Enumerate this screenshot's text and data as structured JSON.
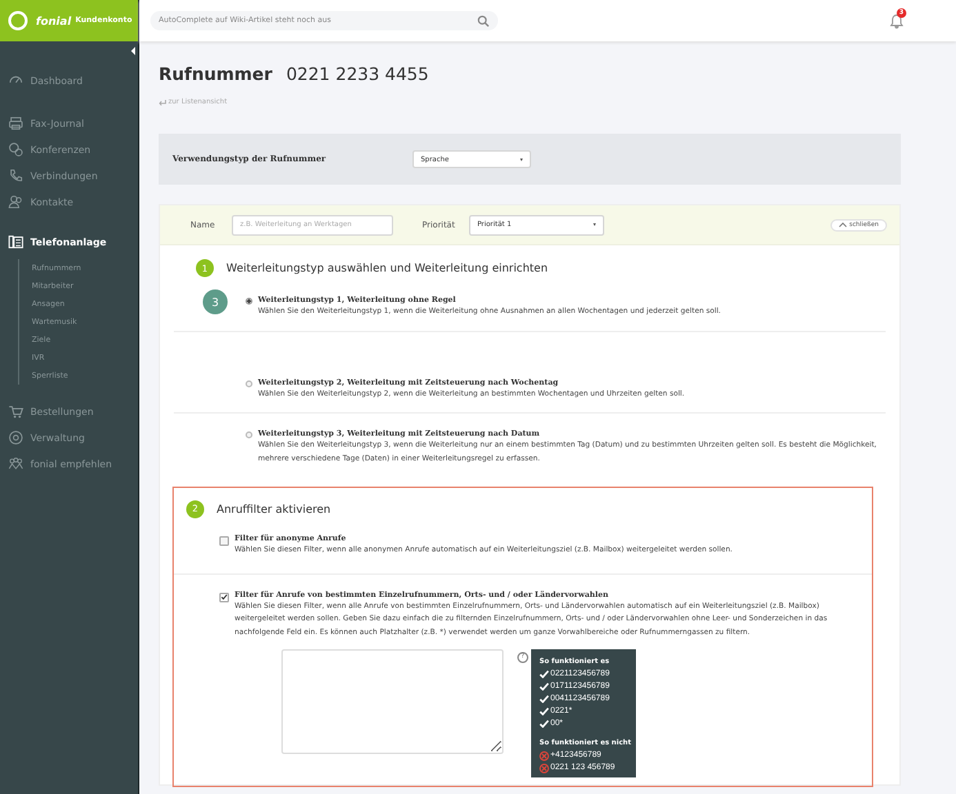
{
  "app": {
    "brand": "fonial",
    "brand_suffix": "Kundenkonto",
    "search": {
      "placeholder": "AutoComplete auf Wiki-Artikel steht noch aus"
    },
    "notifications": {
      "count": "3"
    }
  },
  "sidebar": {
    "items": [
      {
        "label": "Dashboard",
        "selected": false
      },
      {
        "label": "Fax-Journal",
        "selected": false
      },
      {
        "label": "Konferenzen",
        "selected": false
      },
      {
        "label": "Verbindungen",
        "selected": false
      },
      {
        "label": "Kontakte",
        "selected": false
      },
      {
        "label": "Telefonanlage",
        "selected": true,
        "children": [
          {
            "label": "Rufnummern",
            "selected": false
          },
          {
            "label": "Mitarbeiter",
            "selected": false
          },
          {
            "label": "Ansagen",
            "selected": false
          },
          {
            "label": "Wartemusik",
            "selected": false
          },
          {
            "label": "Ziele",
            "selected": false
          },
          {
            "label": "IVR",
            "selected": false
          },
          {
            "label": "Sperrliste",
            "selected": false
          }
        ]
      },
      {
        "label": "Bestellungen",
        "selected": false
      },
      {
        "label": "Verwaltung",
        "selected": false
      },
      {
        "label": "fonial empfehlen",
        "selected": false
      }
    ]
  },
  "page": {
    "title": "Rufnummer",
    "number": "0221 2233 4455",
    "back_link": "zur Listenansicht"
  },
  "usage": {
    "label": "Verwendungstyp der Rufnummer",
    "value": "Sprache"
  },
  "rule": {
    "name_label": "Name",
    "name_placeholder": "z.B. Weiterleitung an Werktagen",
    "priority_label": "Priorität",
    "priority_value": "Priorität 1",
    "close_button": "schließen"
  },
  "step1": {
    "number": "1",
    "title": "Weiterleitungstyp auswählen und Weiterleitung einrichten",
    "marker": "3",
    "options": [
      {
        "title": "Weiterleitungstyp 1, Weiterleitung ohne Regel",
        "description": "Wählen Sie den Weiterleitungstyp 1, wenn die Weiterleitung ohne Ausnahmen an allen Wochentagen und jederzeit gelten soll.",
        "selected": true
      },
      {
        "title": "Weiterleitungstyp 2, Weiterleitung mit Zeitsteuerung nach Wochentag",
        "description": "Wählen Sie den Weiterleitungstyp 2, wenn die Weiterleitung an bestimmten Wochentagen und Uhrzeiten gelten soll.",
        "selected": false
      },
      {
        "title": "Weiterleitungstyp 3, Weiterleitung mit Zeitsteuerung nach Datum",
        "description": "Wählen Sie den Weiterleitungstyp 3, wenn die Weiterleitung nur an einem bestimmten Tag (Datum) und zu bestimmten Uhrzeiten gelten soll. Es besteht die Möglichkeit, mehrere verschiedene Tage (Daten) in einer Weiterleitungsregel zu erfassen.",
        "selected": false
      }
    ]
  },
  "step2": {
    "number": "2",
    "title": "Anruffilter aktivieren",
    "filters": [
      {
        "title": "Filter für anonyme Anrufe",
        "description": "Wählen Sie diesen Filter, wenn alle anonymen Anrufe automatisch auf ein Weiterleitungsziel (z.B. Mailbox) weitergeleitet werden sollen.",
        "checked": false,
        "kind": "plain"
      },
      {
        "title": "Filter für Anrufe von bestimmten Einzelrufnummern, Orts- und / oder Ländervorwahlen",
        "description": "Wählen Sie diesen Filter, wenn alle Anrufe von bestimmten Einzelrufnummern, Orts- und Ländervorwahlen automatisch auf ein Weiterleitungsziel (z.B. Mailbox) weitergeleitet werden sollen. Geben Sie dazu einfach die zu filternden Einzelrufnummern, Orts- und / oder Ländervorwahlen ohne Leer- und Sonderzeichen in das nachfolgende Feld ein. Es können auch Platzhalter (z.B. *) verwendet werden um ganze Vorwahlbereiche oder Rufnummerngassen zu filtern.",
        "checked": true,
        "kind": "with_field"
      }
    ],
    "help": {
      "icon_text": "?",
      "ok_title": "So funktioniert es",
      "ok": [
        "0221123456789",
        "0171123456789",
        "0041123456789",
        "0221*",
        "00*"
      ],
      "bad_title": "So funktioniert es nicht",
      "bad": [
        "+4123456789",
        "0221 123 456789"
      ]
    }
  }
}
